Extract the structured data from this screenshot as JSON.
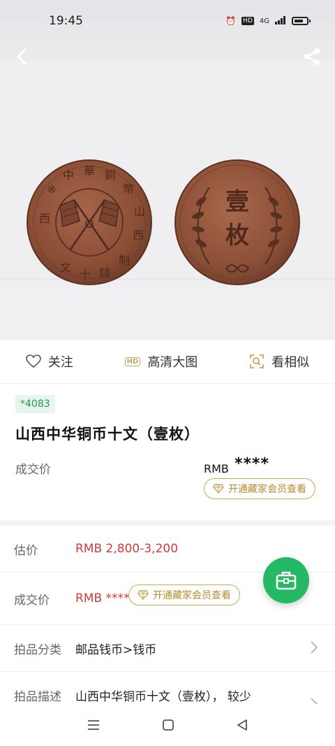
{
  "status_bar": {
    "time": "19:45",
    "network": "4G"
  },
  "actions": {
    "follow": "关注",
    "hd_badge": "HD",
    "hd_image": "高清大图",
    "similar": "看相似"
  },
  "lot": {
    "badge": "*4083",
    "title": "山西中华铜币十文（壹枚）",
    "price_label": "成交价",
    "price_currency": "RMB",
    "price_masked": "****",
    "vip_button": "开通藏家会员查看"
  },
  "details": {
    "estimate_label": "估价",
    "estimate_value": "RMB  2,800-3,200",
    "sold_label": "成交价",
    "sold_value": "RMB ****",
    "vip_button": "开通藏家会员查看",
    "category_label": "拍品分类",
    "category_value": "邮品钱币>钱币",
    "desc_label": "拍品描述",
    "desc_value": "山西中华铜币十文（壹枚），  较少"
  },
  "colors": {
    "accent_green": "#25b865",
    "price_red": "#d23c3c",
    "vip_gold": "#c9a75a",
    "coin_copper": "#8a4e35"
  },
  "icons": [
    "back-arrow-icon",
    "share-icon",
    "heart-icon",
    "hd-icon",
    "scan-similar-icon",
    "diamond-icon",
    "chevron-right-icon",
    "briefcase-icon",
    "menu-icon",
    "home-square-icon",
    "back-triangle-icon"
  ]
}
